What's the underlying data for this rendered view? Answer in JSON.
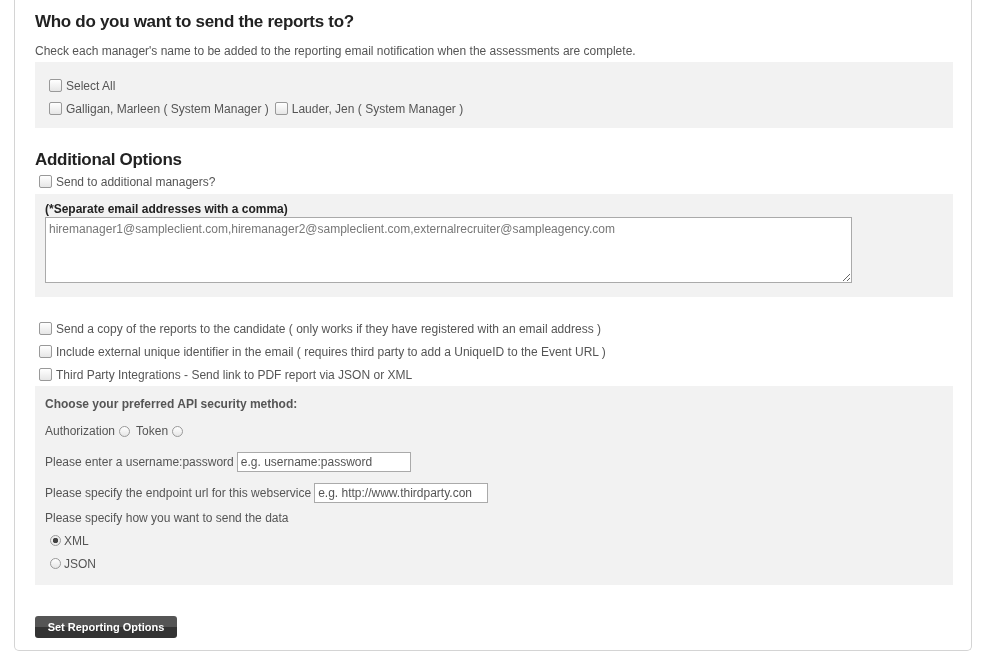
{
  "recipients": {
    "heading": "Who do you want to send the reports to?",
    "hint": "Check each manager's name to be added to the reporting email notification when the assessments are complete.",
    "select_all": {
      "label": "Select All",
      "checked": false
    },
    "managers": [
      {
        "label": "Galligan, Marleen ( System Manager )",
        "checked": false
      },
      {
        "label": "Lauder, Jen ( System Manager )",
        "checked": false
      }
    ]
  },
  "additional": {
    "heading": "Additional Options",
    "send_additional": {
      "label": "Send to additional managers?",
      "checked": false
    },
    "emails_label": "(*Separate email addresses with a comma)",
    "emails_placeholder": "hiremanager1@sampleclient.com,hiremanager2@sampleclient.com,externalrecruiter@sampleagency.com",
    "options": [
      {
        "label": "Send a copy of the reports to the candidate ( only works if they have registered with an email address )",
        "checked": false
      },
      {
        "label": "Include external unique identifier in the email ( requires third party to add a UniqueID to the Event URL )",
        "checked": false
      },
      {
        "label": "Third Party Integrations - Send link to PDF report via JSON or XML",
        "checked": false
      }
    ]
  },
  "api": {
    "heading": "Choose your preferred API security method:",
    "methods": [
      {
        "label": "Authorization",
        "selected": false
      },
      {
        "label": "Token",
        "selected": false
      }
    ],
    "credentials_label": "Please enter a username:password",
    "credentials_placeholder": "e.g. username:password",
    "endpoint_label": "Please specify the endpoint url for this webservice",
    "endpoint_placeholder": "e.g. http://www.thirdparty.con",
    "format_label": "Please specify how you want to send the data",
    "formats": [
      {
        "label": "XML",
        "selected": true
      },
      {
        "label": "JSON",
        "selected": false
      }
    ]
  },
  "submit": "Set Reporting Options"
}
